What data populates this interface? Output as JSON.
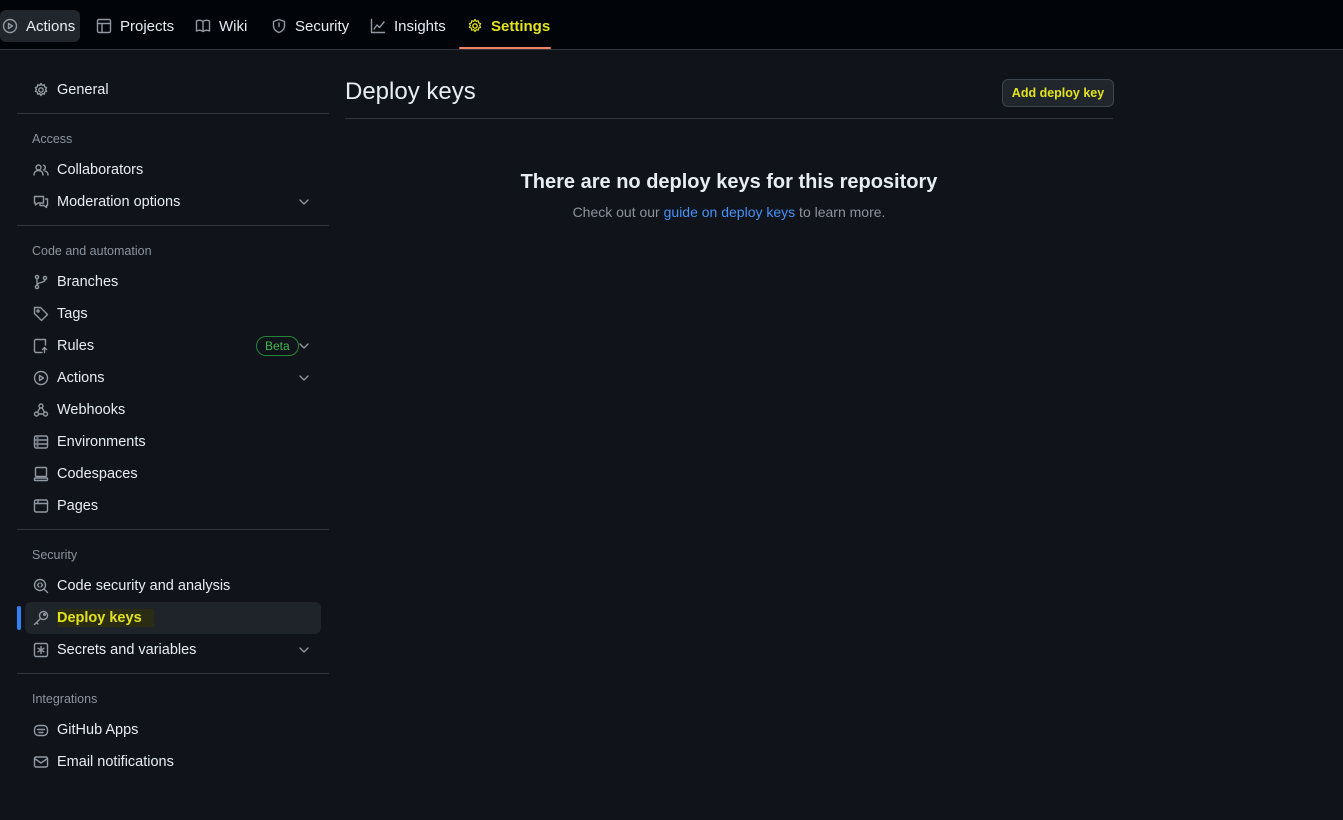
{
  "top_nav": {
    "tabs": [
      {
        "label": "Actions",
        "icon": "play-circle-icon"
      },
      {
        "label": "Projects",
        "icon": "table-icon"
      },
      {
        "label": "Wiki",
        "icon": "book-icon"
      },
      {
        "label": "Security",
        "icon": "shield-icon"
      },
      {
        "label": "Insights",
        "icon": "graph-icon"
      },
      {
        "label": "Settings",
        "icon": "gear-icon"
      }
    ],
    "selected": "Settings"
  },
  "sidebar": {
    "general": "General",
    "sections": [
      {
        "heading": "Access",
        "items": [
          "Collaborators",
          "Moderation options"
        ]
      },
      {
        "heading": "Code and automation",
        "items": [
          "Branches",
          "Tags",
          "Rules",
          "Actions",
          "Webhooks",
          "Environments",
          "Codespaces",
          "Pages"
        ]
      },
      {
        "heading": "Security",
        "items": [
          "Code security and analysis",
          "Deploy keys",
          "Secrets and variables"
        ]
      },
      {
        "heading": "Integrations",
        "items": [
          "GitHub Apps",
          "Email notifications"
        ]
      }
    ],
    "rules_badge": "Beta",
    "active_item": "Deploy keys"
  },
  "main": {
    "title": "Deploy keys",
    "add_button": "Add deploy key",
    "empty_title": "There are no deploy keys for this repository",
    "empty_desc_prefix": "Check out our ",
    "empty_desc_link": "guide on deploy keys",
    "empty_desc_suffix": " to learn more."
  },
  "colors": {
    "background": "#10131a",
    "accent_highlight": "#e3e31c",
    "active_bar": "#2f81f7",
    "link": "#4493f8",
    "underline": "#f78166"
  }
}
